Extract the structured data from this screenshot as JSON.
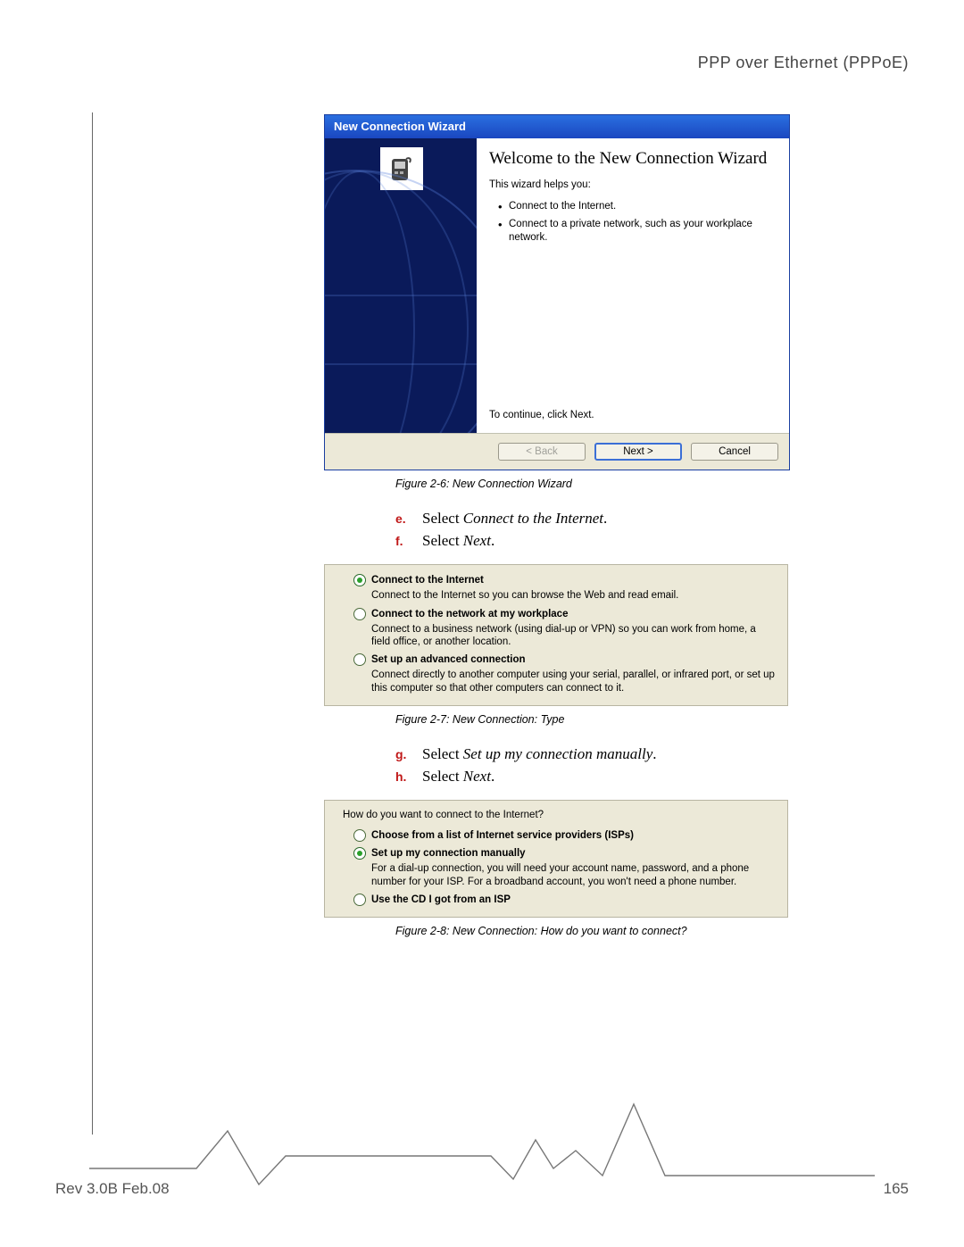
{
  "header": {
    "title": "PPP over Ethernet (PPPoE)"
  },
  "wizard": {
    "titlebar": "New Connection Wizard",
    "heading": "Welcome to the New Connection Wizard",
    "helps": "This wizard helps you:",
    "bullets": [
      "Connect to the Internet.",
      "Connect to a private network, such as your workplace network."
    ],
    "continue": "To continue, click Next.",
    "buttons": {
      "back": "< Back",
      "next": "Next >",
      "cancel": "Cancel"
    }
  },
  "captions": {
    "c1": "Figure 2-6:  New Connection Wizard",
    "c2": "Figure 2-7:  New Connection: Type",
    "c3": "Figure 2-8:  New Connection: How do you want to connect?"
  },
  "instr": {
    "e_letter": "e.",
    "e_pre": "Select ",
    "e_it": "Connect to the Internet",
    "e_post": ".",
    "f_letter": "f.",
    "f_pre": "Select ",
    "f_it": "Next",
    "f_post": ".",
    "g_letter": "g.",
    "g_pre": "Select ",
    "g_it": "Set up my connection manually",
    "g_post": ".",
    "h_letter": "h.",
    "h_pre": "Select ",
    "h_it": "Next",
    "h_post": "."
  },
  "panel1": {
    "opt1_title": "Connect to the Internet",
    "opt1_desc": "Connect to the Internet so you can browse the Web and read email.",
    "opt2_title": "Connect to the network at my workplace",
    "opt2_desc": "Connect to a business network (using dial-up or VPN) so you can work from home, a field office, or another location.",
    "opt3_title": "Set up an advanced connection",
    "opt3_desc": "Connect directly to another computer using your serial, parallel, or infrared port, or set up this computer so that other computers can connect to it."
  },
  "panel2": {
    "question": "How do you want to connect to the Internet?",
    "opt1_title": "Choose from a list of Internet service providers (ISPs)",
    "opt2_title": "Set up my connection manually",
    "opt2_desc": "For a dial-up connection, you will need your account name, password, and a phone number for your ISP. For a broadband account, you won't need a phone number.",
    "opt3_title": "Use the CD I got from an ISP"
  },
  "footer": {
    "rev": "Rev 3.0B Feb.08",
    "page": "165"
  }
}
